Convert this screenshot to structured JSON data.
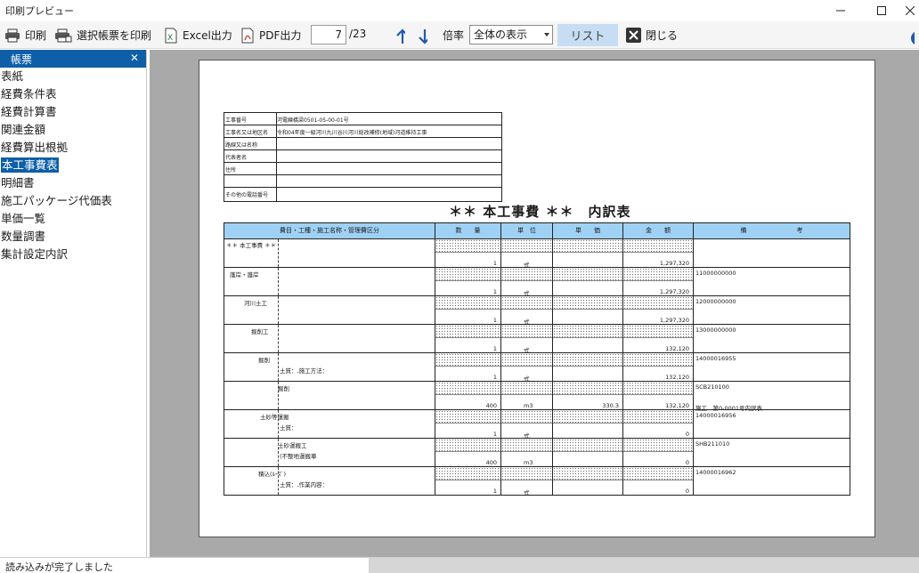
{
  "window": {
    "title": "印刷プレビュー"
  },
  "toolbar": {
    "print_label": "印刷",
    "print_selected_label": "選択帳票を印刷",
    "excel_label": "Excel出力",
    "pdf_label": "PDF出力",
    "page_current": "7",
    "page_total": "/23",
    "zoom_label": "倍率",
    "zoom_value": "全体の表示",
    "list_label": "リスト",
    "close_label": "閉じる"
  },
  "sidebar": {
    "title": "帳票",
    "items": [
      {
        "label": "表紙"
      },
      {
        "label": "経費条件表"
      },
      {
        "label": "経費計算書"
      },
      {
        "label": "関連金額"
      },
      {
        "label": "経費算出根拠"
      },
      {
        "label": "本工事費表"
      },
      {
        "label": "明細書"
      },
      {
        "label": "施工パッケージ代価表"
      },
      {
        "label": "単価一覧"
      },
      {
        "label": "数量調書"
      },
      {
        "label": "集計設定内訳"
      }
    ],
    "selected_index": 5
  },
  "document": {
    "info": [
      {
        "label": "工事番号",
        "value": "河電練橋梁0501-05-00-01号"
      },
      {
        "label": "工事名又は地区名",
        "value": "令和04年度一級河川九川谷川河川総改補修(地域)河道維持工事"
      },
      {
        "label": "路線又は名称",
        "value": ""
      },
      {
        "label": "代表者名",
        "value": ""
      },
      {
        "label": "住所",
        "value": ""
      },
      {
        "label": "",
        "value": ""
      },
      {
        "label": "その他の電話番号",
        "value": ""
      }
    ],
    "title": "＊＊ 本工事費 ＊＊　内訳表",
    "headers": {
      "name": "費目・工種・施工名称・管理費区分",
      "qty": "数　　量",
      "unit": "単　位",
      "price": "単　　価",
      "amount": "金　　額",
      "note": "備　　　　　　　　考"
    },
    "rows": [
      {
        "name": "＊＊ 本工事費 ＊＊",
        "sub": "",
        "qty": "",
        "unit": "",
        "price": "",
        "amount": "",
        "note": "",
        "note2": ""
      },
      {
        "name": "",
        "sub": "",
        "qty": "1",
        "unit": "式",
        "price": "",
        "amount": "1,297,320",
        "note": "",
        "note2": ""
      },
      {
        "name": "護岸・護岸",
        "sub": "",
        "qty": "1",
        "unit": "式",
        "price": "",
        "amount": "1,297,320",
        "note": "11000000000",
        "note2": ""
      },
      {
        "name": "河川土工",
        "sub": "",
        "qty": "1",
        "unit": "式",
        "price": "",
        "amount": "1,297,320",
        "note": "12000000000",
        "note2": ""
      },
      {
        "name": "掘削工",
        "sub": "",
        "qty": "1",
        "unit": "式",
        "price": "",
        "amount": "132,120",
        "note": "13000000000",
        "note2": ""
      },
      {
        "name": "掘削",
        "sub": "土質：,施工方法：",
        "qty": "1",
        "unit": "式",
        "price": "",
        "amount": "132,120",
        "note": "14000016955",
        "note2": ""
      },
      {
        "name": "掘削",
        "sub": "",
        "qty": "400",
        "unit": "m3",
        "price": "330.3",
        "amount": "132,120",
        "note": "SCB210100",
        "note2": "施工　第0-0001号内訳表"
      },
      {
        "name": "土砂等運搬",
        "sub": "土質：",
        "qty": "1",
        "unit": "式",
        "price": "",
        "amount": "0",
        "note": "14000016956",
        "note2": ""
      },
      {
        "name": "土砂運搬工",
        "sub": "(不整地運搬車",
        "qty": "400",
        "unit": "m3",
        "price": "",
        "amount": "0",
        "note": "SHB211010",
        "note2": ""
      },
      {
        "name": "積込(ﾙｰｽﾞ)",
        "sub": "土質：,作業内容：",
        "qty": "1",
        "unit": "式",
        "price": "",
        "amount": "0",
        "note": "14000016962",
        "note2": ""
      }
    ]
  },
  "status": {
    "text": "読み込みが完了しました"
  }
}
